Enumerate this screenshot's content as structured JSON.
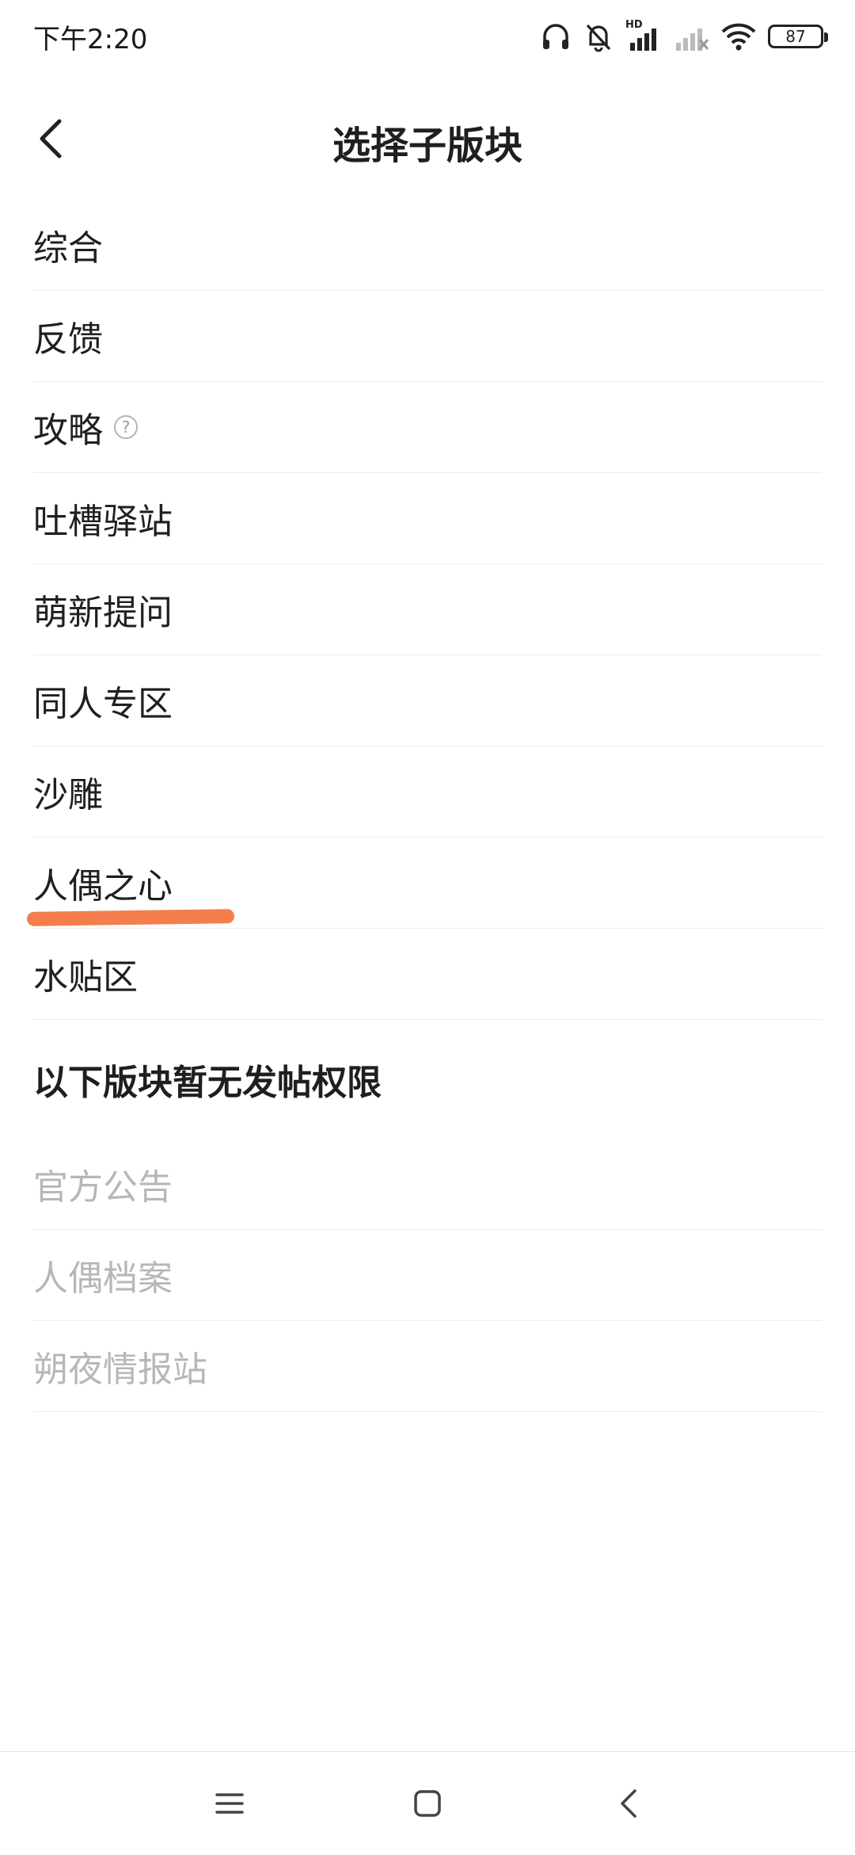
{
  "status_bar": {
    "time": "下午2:20",
    "network_label": "HD",
    "battery": "87",
    "icons": [
      "headphones-icon",
      "bell-muted-icon",
      "signal-icon",
      "signal-weak-icon",
      "wifi-icon",
      "battery-icon"
    ]
  },
  "header": {
    "title": "选择子版块",
    "back_icon": "chevron-left-icon"
  },
  "sections": {
    "available": {
      "items": [
        {
          "label": "综合"
        },
        {
          "label": "反馈"
        },
        {
          "label": "攻略",
          "help": "?"
        },
        {
          "label": "吐槽驿站"
        },
        {
          "label": "萌新提问"
        },
        {
          "label": "同人专区"
        },
        {
          "label": "沙雕"
        },
        {
          "label": "人偶之心"
        },
        {
          "label": "水贴区"
        }
      ]
    },
    "restricted": {
      "title": "以下版块暂无发帖权限",
      "items": [
        {
          "label": "官方公告"
        },
        {
          "label": "人偶档案"
        },
        {
          "label": "朔夜情报站"
        }
      ]
    }
  },
  "annotation": {
    "color": "#f47e4c"
  },
  "nav_bar": {
    "icons": [
      "menu-icon",
      "home-icon",
      "back-icon"
    ]
  }
}
